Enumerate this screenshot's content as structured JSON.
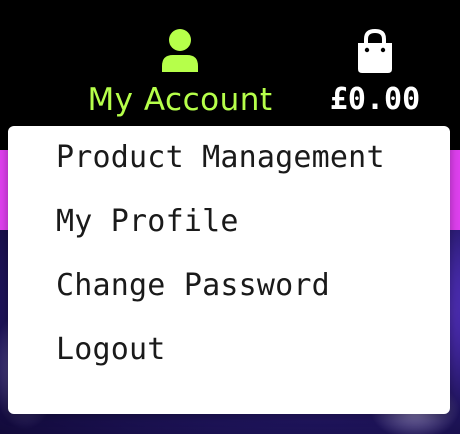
{
  "header": {
    "account": {
      "icon": "user-icon",
      "label": "My Account",
      "color": "#b6ff4a"
    },
    "cart": {
      "icon": "shopping-bag-icon",
      "total": "£0.00"
    }
  },
  "account_menu": {
    "items": [
      {
        "label": "Product Management"
      },
      {
        "label": "My Profile"
      },
      {
        "label": "Change Password"
      },
      {
        "label": "Logout"
      }
    ]
  },
  "colors": {
    "header_bg": "#000000",
    "accent_green": "#b6ff4a",
    "banner_magenta": "#e040f0",
    "menu_bg": "#ffffff"
  }
}
